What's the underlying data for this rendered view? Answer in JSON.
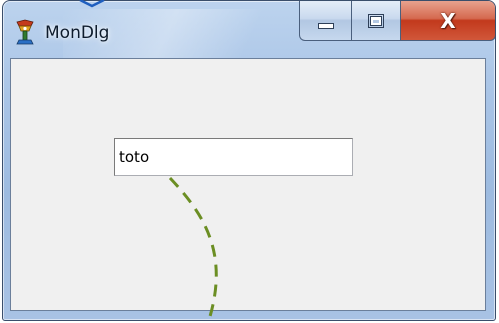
{
  "window": {
    "title": "MonDlg",
    "app_icon": "app-gear-icon",
    "buttons": {
      "minimize_icon": "minimize-icon",
      "maximize_icon": "maximize-icon",
      "close_glyph": "X"
    }
  },
  "dialog": {
    "edit_value": "toto"
  },
  "colors": {
    "client_bg": "#f0f0f0",
    "frame": "#a9c4e6",
    "close_button": "#c2391c",
    "annotation_curve": "#6b8e23",
    "annotation_arrow": "#1f5fbf"
  }
}
